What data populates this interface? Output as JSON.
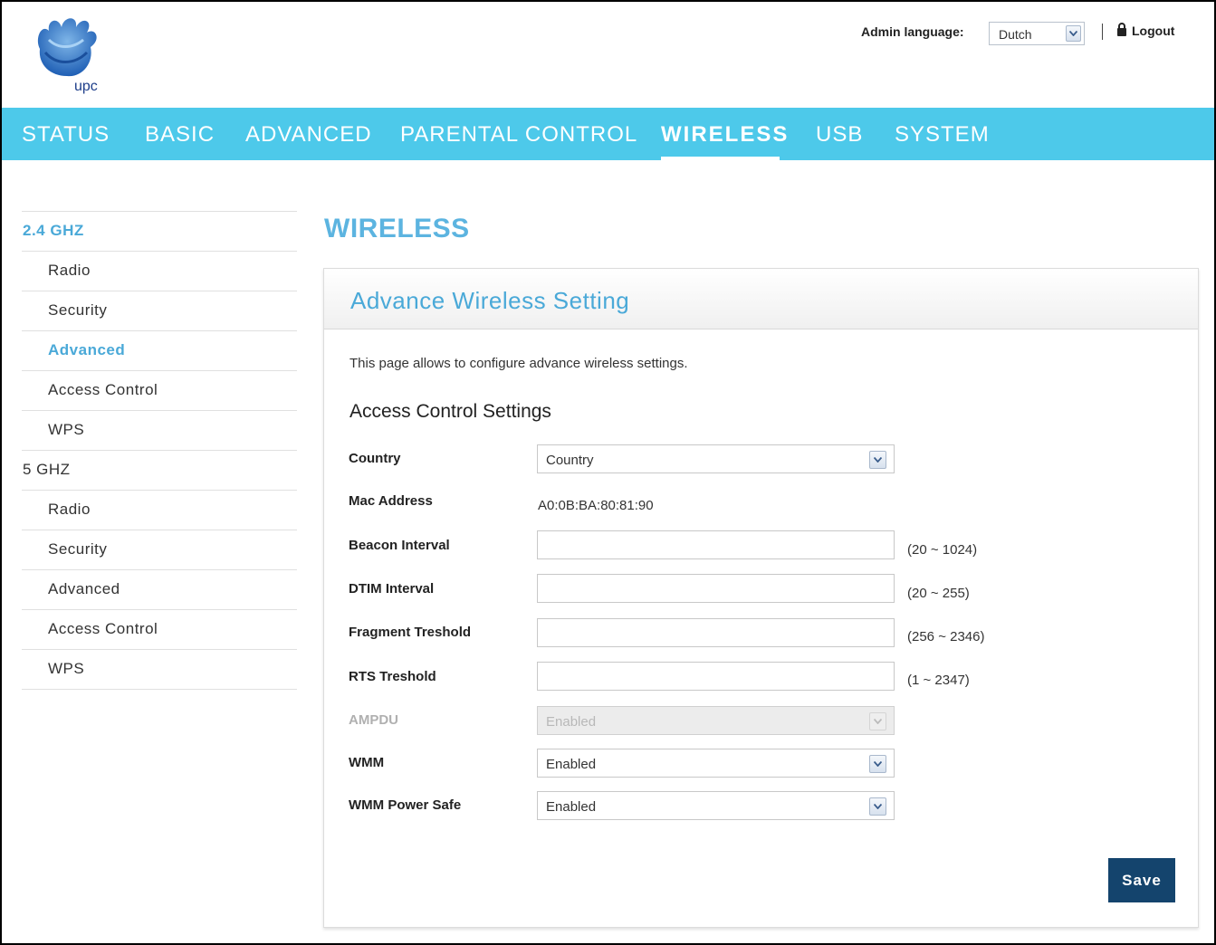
{
  "brand": {
    "logo_text": "upc"
  },
  "header": {
    "admin_language_label": "Admin language:",
    "admin_language_value": "Dutch",
    "logout_label": "Logout"
  },
  "nav": {
    "items": [
      "STATUS",
      "BASIC",
      "ADVANCED",
      "PARENTAL CONTROL",
      "WIRELESS",
      "USB",
      "SYSTEM"
    ],
    "active": "WIRELESS"
  },
  "sidebar": {
    "items": [
      {
        "label": "2.4 GHZ",
        "kind": "group",
        "active": true
      },
      {
        "label": "Radio",
        "kind": "sub"
      },
      {
        "label": "Security",
        "kind": "sub"
      },
      {
        "label": "Advanced",
        "kind": "sub",
        "active": true
      },
      {
        "label": "Access Control",
        "kind": "sub"
      },
      {
        "label": "WPS",
        "kind": "sub"
      },
      {
        "label": "5 GHZ",
        "kind": "group"
      },
      {
        "label": "Radio",
        "kind": "sub"
      },
      {
        "label": "Security",
        "kind": "sub"
      },
      {
        "label": "Advanced",
        "kind": "sub"
      },
      {
        "label": "Access Control",
        "kind": "sub"
      },
      {
        "label": "WPS",
        "kind": "sub"
      }
    ]
  },
  "main": {
    "page_title": "WIRELESS",
    "panel_title": "Advance Wireless Setting",
    "description": "This page allows to configure advance wireless settings.",
    "section_title": "Access Control Settings",
    "fields": {
      "country": {
        "label": "Country",
        "value": "Country"
      },
      "mac_address": {
        "label": "Mac Address",
        "value": "A0:0B:BA:80:81:90"
      },
      "beacon_interval": {
        "label": "Beacon Interval",
        "value": "",
        "range": "(20 ~ 1024)"
      },
      "dtim_interval": {
        "label": "DTIM Interval",
        "value": "",
        "range": "(20 ~ 255)"
      },
      "fragment_threshold": {
        "label": "Fragment Treshold",
        "value": "",
        "range": "(256 ~ 2346)"
      },
      "rts_threshold": {
        "label": "RTS Treshold",
        "value": "",
        "range": "(1 ~ 2347)"
      },
      "ampdu": {
        "label": "AMPDU",
        "value": "Enabled",
        "disabled": true
      },
      "wmm": {
        "label": "WMM",
        "value": "Enabled"
      },
      "wmm_power_safe": {
        "label": "WMM Power Safe",
        "value": "Enabled"
      }
    },
    "save_label": "Save"
  },
  "colors": {
    "nav_bg": "#4dc9ea",
    "accent_blue": "#4aa9d8",
    "save_button": "#14446d"
  },
  "icons": [
    "upc-logo",
    "chevron-down-icon",
    "lock-icon"
  ]
}
